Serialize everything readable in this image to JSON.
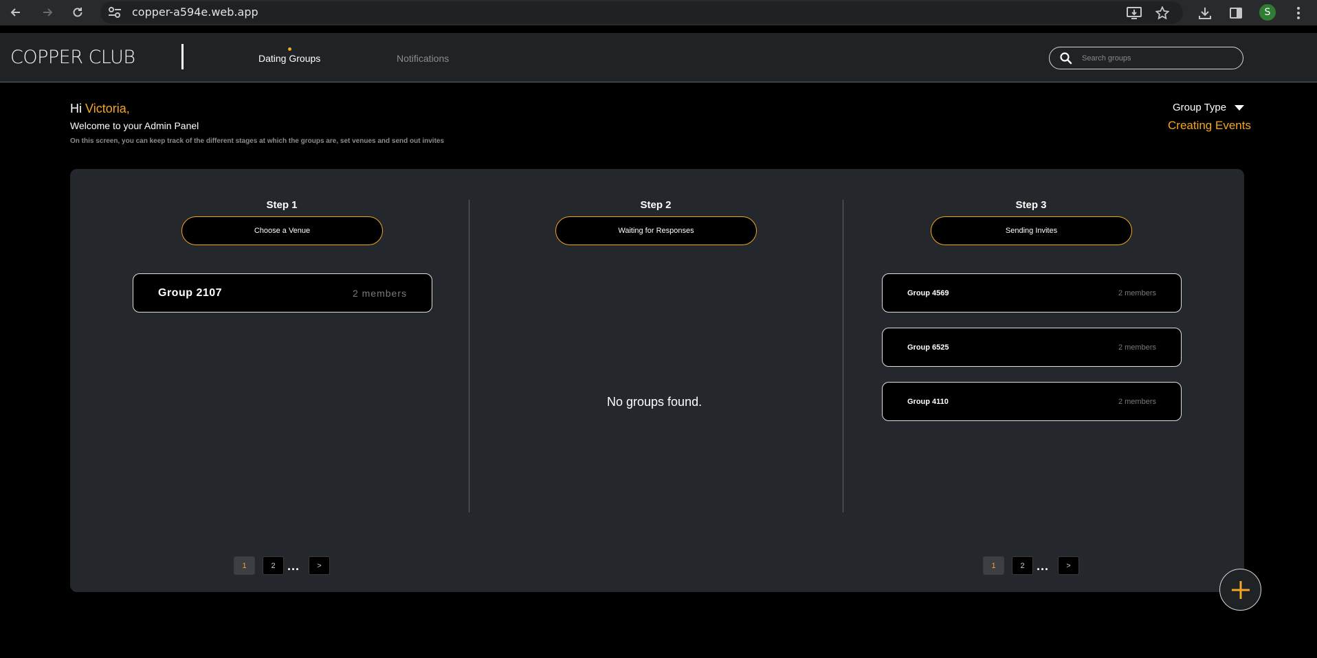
{
  "browser": {
    "url": "copper-a594e.web.app",
    "profile_initial": "S"
  },
  "header": {
    "logo": "COPPER CLUB",
    "tabs": [
      {
        "label": "Dating Groups",
        "active": true
      },
      {
        "label": "Notifications",
        "active": false
      }
    ],
    "search_placeholder": "Search groups"
  },
  "greeting": {
    "hi": "Hi",
    "name": "Victoria,",
    "welcome": "Welcome to your Admin Panel",
    "subtitle": "On this screen, you can keep track of the different stages at which the groups are, set venues and send out invites"
  },
  "filter": {
    "label": "Group Type",
    "value": "Creating Events"
  },
  "steps": [
    {
      "title": "Step 1",
      "button": "Choose a Venue",
      "groups": [
        {
          "name": "Group 2107",
          "members": "2 members"
        }
      ]
    },
    {
      "title": "Step 2",
      "button": "Waiting for Responses",
      "empty_message": "No groups found."
    },
    {
      "title": "Step 3",
      "button": "Sending Invites",
      "groups": [
        {
          "name": "Group 4569",
          "members": "2 members"
        },
        {
          "name": "Group 6525",
          "members": "2 members"
        },
        {
          "name": "Group 4110",
          "members": "2 members"
        }
      ]
    }
  ],
  "pagination": {
    "pages": [
      "1",
      "2"
    ],
    "ellipsis": "...",
    "next": ">",
    "current": "1"
  },
  "fab_label": "+",
  "colors": {
    "accent": "#f5a623",
    "panel": "#24272b",
    "header": "#202326",
    "background": "#000000"
  }
}
